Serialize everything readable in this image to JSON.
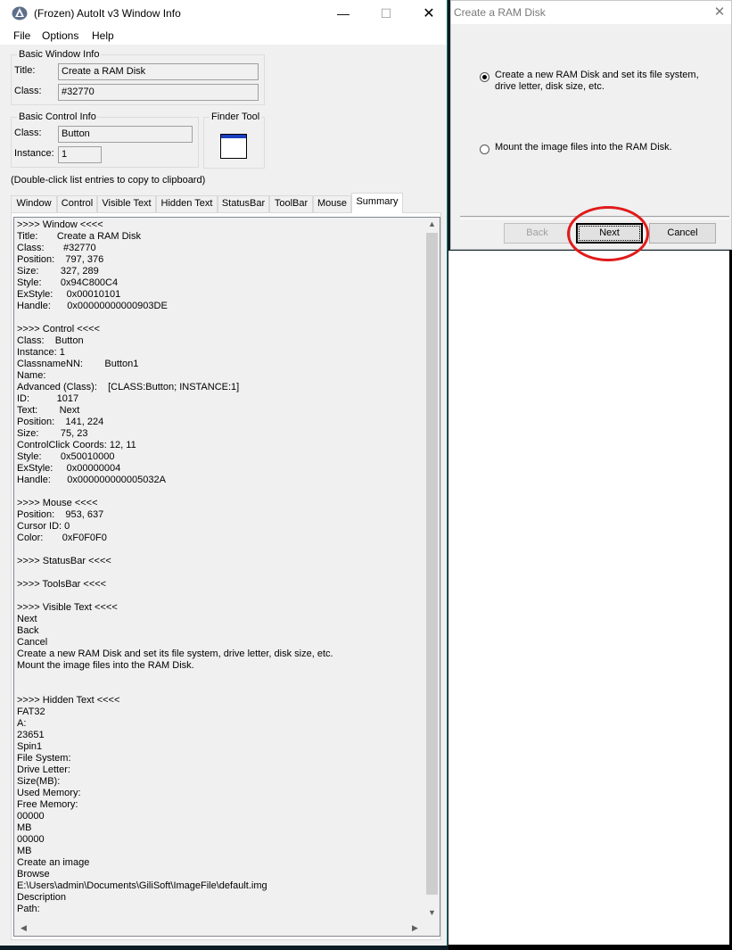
{
  "autoit": {
    "title": "(Frozen) AutoIt v3 Window Info",
    "menu": [
      "File",
      "Options",
      "Help"
    ],
    "basic_window": {
      "legend": "Basic Window Info",
      "title_label": "Title:",
      "title_value": "Create a RAM Disk",
      "class_label": "Class:",
      "class_value": "#32770"
    },
    "basic_control": {
      "legend": "Basic Control Info",
      "class_label": "Class:",
      "class_value": "Button",
      "instance_label": "Instance:",
      "instance_value": "1"
    },
    "finder": {
      "legend": "Finder Tool"
    },
    "hint": "(Double-click list entries to copy to clipboard)",
    "tabs": [
      "Window",
      "Control",
      "Visible Text",
      "Hidden Text",
      "StatusBar",
      "ToolBar",
      "Mouse",
      "Summary"
    ],
    "active_tab": "Summary",
    "summary_lines": [
      ">>>> Window <<<<",
      "Title:       Create a RAM Disk",
      "Class:       #32770",
      "Position:    797, 376",
      "Size:        327, 289",
      "Style:       0x94C800C4",
      "ExStyle:     0x00010101",
      "Handle:      0x00000000000903DE",
      "",
      ">>>> Control <<<<",
      "Class:    Button",
      "Instance: 1",
      "ClassnameNN:        Button1",
      "Name:",
      "Advanced (Class):    [CLASS:Button; INSTANCE:1]",
      "ID:          1017",
      "Text:        Next",
      "Position:    141, 224",
      "Size:        75, 23",
      "ControlClick Coords: 12, 11",
      "Style:       0x50010000",
      "ExStyle:     0x00000004",
      "Handle:      0x000000000005032A",
      "",
      ">>>> Mouse <<<<",
      "Position:    953, 637",
      "Cursor ID: 0",
      "Color:       0xF0F0F0",
      "",
      ">>>> StatusBar <<<<",
      "",
      ">>>> ToolsBar <<<<",
      "",
      ">>>> Visible Text <<<<",
      "Next",
      "Back",
      "Cancel",
      "Create a new RAM Disk and set its file system, drive letter, disk size, etc.",
      "Mount the image files into the RAM Disk.",
      "",
      "",
      ">>>> Hidden Text <<<<",
      "FAT32",
      "A:",
      "23651",
      "Spin1",
      "File System:",
      "Drive Letter:",
      "Size(MB):",
      "Used Memory:",
      "Free Memory:",
      "00000",
      "MB",
      "00000",
      "MB",
      "Create an image",
      "Browse",
      "E:\\Users\\admin\\Documents\\GiliSoft\\ImageFile\\default.img",
      "Description",
      "Path:"
    ]
  },
  "ramdisk": {
    "title": "Create a RAM Disk",
    "option_create": "Create a new RAM Disk and set its file system, drive letter, disk size, etc.",
    "option_mount": "Mount the image files into the RAM Disk.",
    "selected_option": "create",
    "buttons": {
      "back": "Back",
      "next": "Next",
      "cancel": "Cancel"
    }
  },
  "icons": {
    "app_icon": "autoit-icon",
    "close": "close-icon",
    "maximize": "maximize-icon",
    "minimize": "minimize-icon",
    "finder": "finder-window-icon"
  },
  "colors": {
    "highlight_ring": "#e01b1b",
    "window_bg": "#f0f0f0",
    "finder_accent": "#1a3fbf"
  }
}
